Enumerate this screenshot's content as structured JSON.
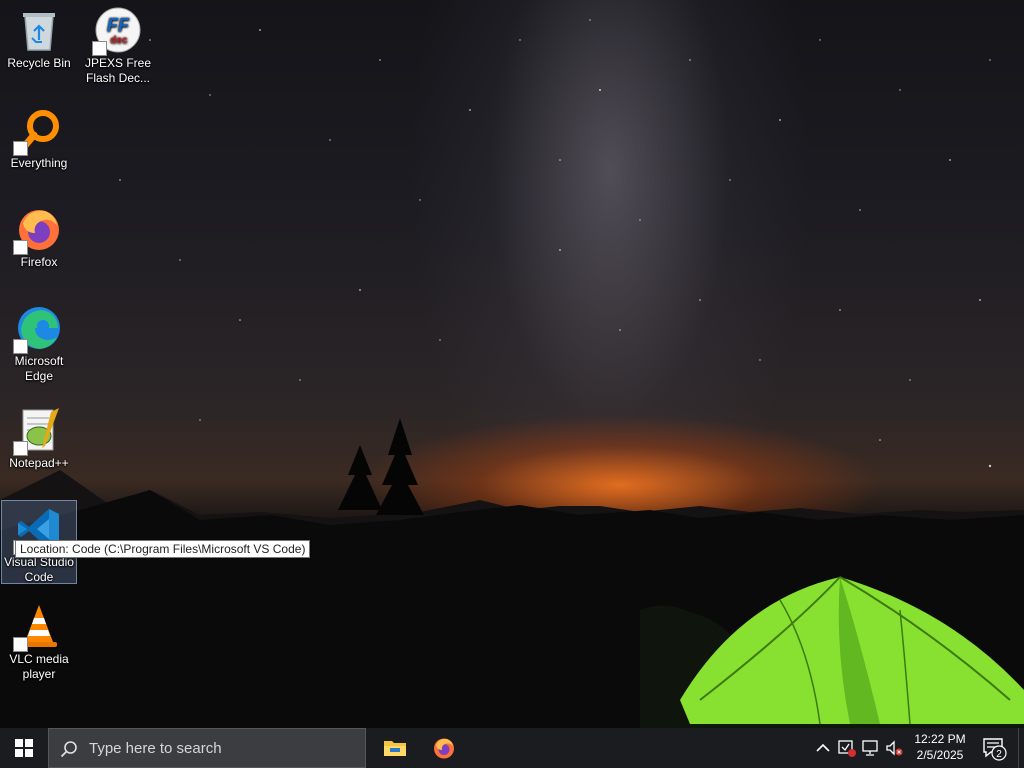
{
  "desktop_icons": [
    {
      "name": "recycle-bin",
      "label": "Recycle Bin"
    },
    {
      "name": "jpexs",
      "label": "JPEXS Free Flash Dec...",
      "glyph_text": "FF",
      "glyph_sub": "dec"
    },
    {
      "name": "everything",
      "label": "Everything"
    },
    {
      "name": "firefox",
      "label": "Firefox"
    },
    {
      "name": "edge",
      "label": "Microsoft Edge"
    },
    {
      "name": "notepadpp",
      "label": "Notepad++"
    },
    {
      "name": "vscode",
      "label": "Visual Studio Code"
    },
    {
      "name": "vlc",
      "label": "VLC media player"
    }
  ],
  "tooltip": {
    "text": "Location: Code (C:\\Program Files\\Microsoft VS Code)"
  },
  "taskbar": {
    "search_placeholder": "Type here to search",
    "clock": {
      "time": "12:22 PM",
      "date": "2/5/2025"
    },
    "notification_count": "2",
    "pinned": [
      "file-explorer",
      "firefox"
    ]
  },
  "colors": {
    "taskbar_bg": "#1b1c1f",
    "search_bg": "#3c3d40",
    "accent_windows": "#ffffff"
  }
}
